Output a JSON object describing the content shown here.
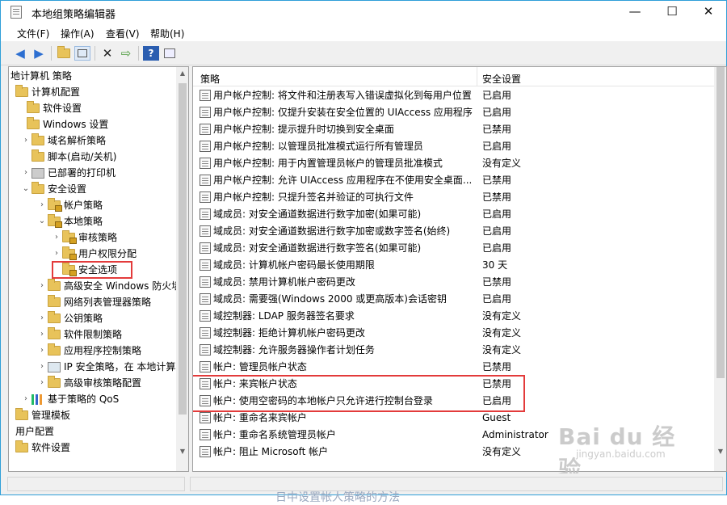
{
  "title": "本地组策略编辑器",
  "window_buttons": [
    "—",
    "☐",
    "✕"
  ],
  "menu": [
    "文件(F)",
    "操作(A)",
    "查看(V)",
    "帮助(H)"
  ],
  "tree": [
    {
      "label": "地计算机 策略",
      "arrow": "",
      "icon": "none"
    },
    {
      "label": "计算机配置",
      "arrow": "",
      "icon": "folder"
    },
    {
      "label": "软件设置",
      "arrow": "",
      "icon": "folder"
    },
    {
      "label": "Windows 设置",
      "arrow": "",
      "icon": "folder"
    },
    {
      "label": "域名解析策略",
      "arrow": "›",
      "icon": "folder"
    },
    {
      "label": "脚本(启动/关机)",
      "arrow": "",
      "icon": "folder"
    },
    {
      "label": "已部署的打印机",
      "arrow": "›",
      "icon": "printer"
    },
    {
      "label": "安全设置",
      "arrow": "⌄",
      "icon": "folder"
    },
    {
      "label": "帐户策略",
      "arrow": "›",
      "icon": "lockfolder"
    },
    {
      "label": "本地策略",
      "arrow": "⌄",
      "icon": "lockfolder"
    },
    {
      "label": "审核策略",
      "arrow": "›",
      "icon": "lockfolder"
    },
    {
      "label": "用户权限分配",
      "arrow": "›",
      "icon": "lockfolder"
    },
    {
      "label": "安全选项",
      "arrow": "",
      "icon": "lockfolder"
    },
    {
      "label": "高级安全 Windows 防火墙",
      "arrow": "›",
      "icon": "folder"
    },
    {
      "label": "网络列表管理器策略",
      "arrow": "",
      "icon": "folder"
    },
    {
      "label": "公钥策略",
      "arrow": "›",
      "icon": "folder"
    },
    {
      "label": "软件限制策略",
      "arrow": "›",
      "icon": "folder"
    },
    {
      "label": "应用程序控制策略",
      "arrow": "›",
      "icon": "folder"
    },
    {
      "label": "IP 安全策略，在 本地计算机",
      "arrow": "›",
      "icon": "ip"
    },
    {
      "label": "高级审核策略配置",
      "arrow": "›",
      "icon": "folder"
    },
    {
      "label": "基于策略的 QoS",
      "arrow": "›",
      "icon": "chart"
    },
    {
      "label": "管理模板",
      "arrow": "",
      "icon": "folder"
    },
    {
      "label": "用户配置",
      "arrow": "",
      "icon": "none"
    },
    {
      "label": "软件设置",
      "arrow": "",
      "icon": "folder"
    }
  ],
  "columns": {
    "policy": "策略",
    "setting": "安全设置"
  },
  "rows": [
    {
      "policy": "用户帐户控制: 将文件和注册表写入错误虚拟化到每用户位置",
      "setting": "已启用"
    },
    {
      "policy": "用户帐户控制: 仅提升安装在安全位置的 UIAccess 应用程序",
      "setting": "已启用"
    },
    {
      "policy": "用户帐户控制: 提示提升时切换到安全桌面",
      "setting": "已禁用"
    },
    {
      "policy": "用户帐户控制: 以管理员批准模式运行所有管理员",
      "setting": "已启用"
    },
    {
      "policy": "用户帐户控制: 用于内置管理员帐户的管理员批准模式",
      "setting": "没有定义"
    },
    {
      "policy": "用户帐户控制: 允许 UIAccess 应用程序在不使用安全桌面...",
      "setting": "已禁用"
    },
    {
      "policy": "用户帐户控制: 只提升签名并验证的可执行文件",
      "setting": "已禁用"
    },
    {
      "policy": "域成员: 对安全通道数据进行数字加密(如果可能)",
      "setting": "已启用"
    },
    {
      "policy": "域成员: 对安全通道数据进行数字加密或数字签名(始终)",
      "setting": "已启用"
    },
    {
      "policy": "域成员: 对安全通道数据进行数字签名(如果可能)",
      "setting": "已启用"
    },
    {
      "policy": "域成员: 计算机帐户密码最长使用期限",
      "setting": "30 天"
    },
    {
      "policy": "域成员: 禁用计算机帐户密码更改",
      "setting": "已禁用"
    },
    {
      "policy": "域成员: 需要强(Windows 2000 或更高版本)会话密钥",
      "setting": "已启用"
    },
    {
      "policy": "域控制器: LDAP 服务器签名要求",
      "setting": "没有定义"
    },
    {
      "policy": "域控制器: 拒绝计算机帐户密码更改",
      "setting": "没有定义"
    },
    {
      "policy": "域控制器: 允许服务器操作者计划任务",
      "setting": "没有定义"
    },
    {
      "policy": "帐户: 管理员帐户状态",
      "setting": "已禁用"
    },
    {
      "policy": "帐户: 来宾帐户状态",
      "setting": "已禁用"
    },
    {
      "policy": "帐户: 使用空密码的本地帐户只允许进行控制台登录",
      "setting": "已启用"
    },
    {
      "policy": "帐户: 重命名来宾帐户",
      "setting": "Guest"
    },
    {
      "policy": "帐户: 重命名系统管理员帐户",
      "setting": "Administrator"
    },
    {
      "policy": "帐户: 阻止 Microsoft 帐户",
      "setting": "没有定义"
    }
  ],
  "watermark": {
    "logo": "Bai du 经验",
    "url": "jingyan.baidu.com"
  },
  "bottom_text": "日中设置帐人策略的方法",
  "colors": {
    "highlight": "#e33b3b",
    "folder": "#e8c35a"
  }
}
